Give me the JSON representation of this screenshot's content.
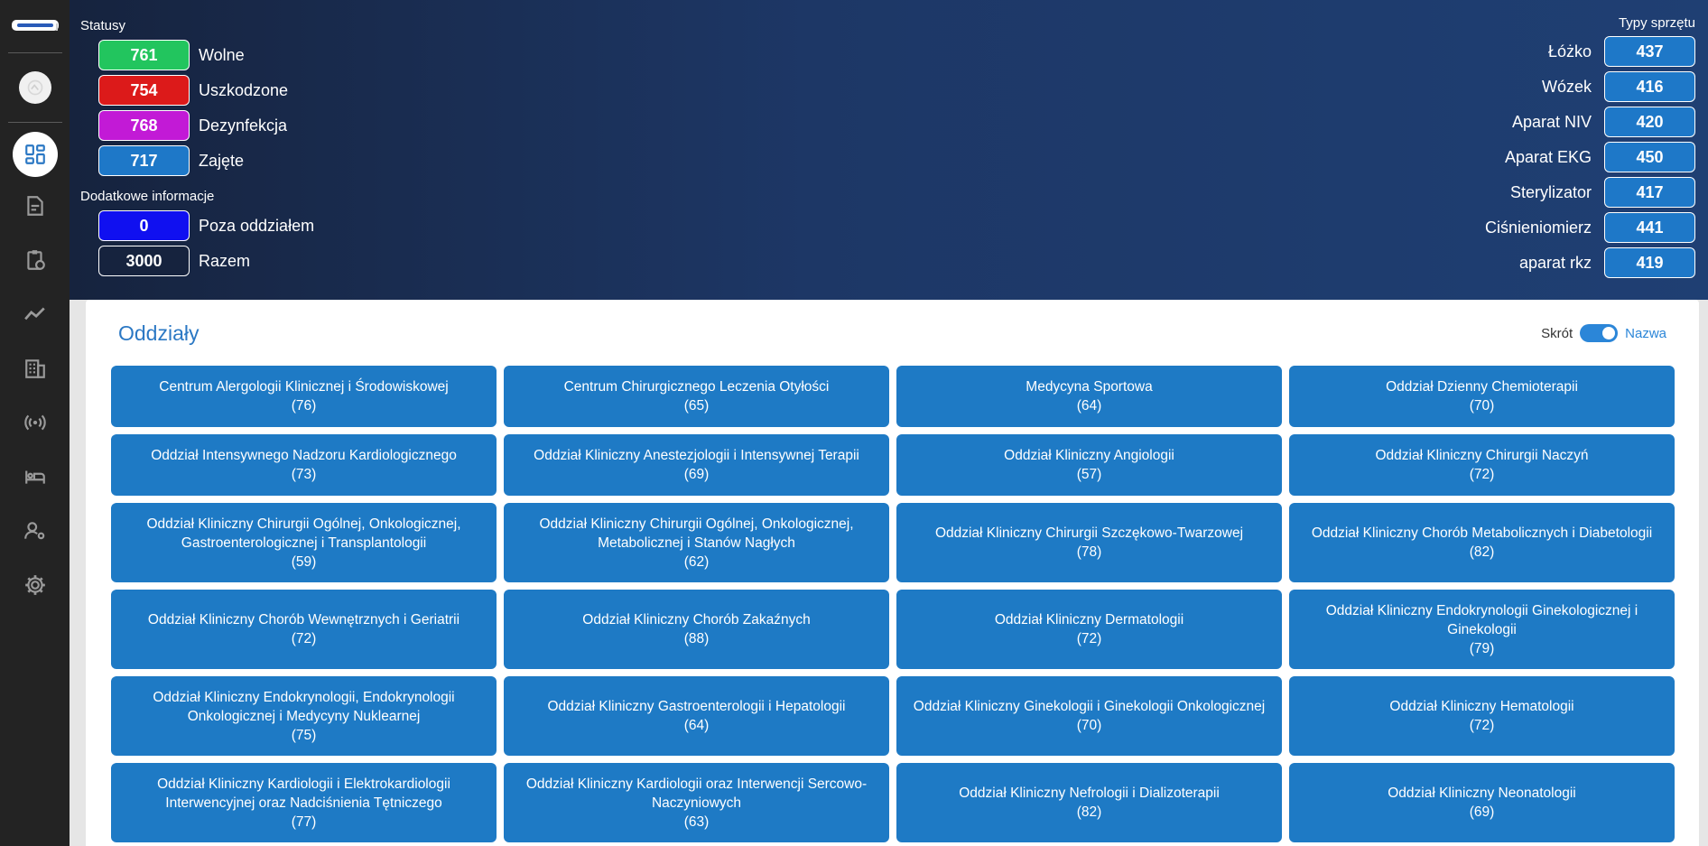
{
  "sidebar": {
    "icons": [
      "logo",
      "avatar-icon",
      "dashboard-icon",
      "document-icon",
      "clipboard-clock-icon",
      "chart-line-icon",
      "building-icon",
      "broadcast-icon",
      "bed-icon",
      "user-gear-icon",
      "gear-icon"
    ],
    "active": "dashboard-icon"
  },
  "statuses": {
    "label": "Statusy",
    "items": [
      {
        "value": "761",
        "label": "Wolne",
        "color": "#22c55e"
      },
      {
        "value": "754",
        "label": "Uszkodzone",
        "color": "#dc1a1a"
      },
      {
        "value": "768",
        "label": "Dezynfekcja",
        "color": "#c21ad6"
      },
      {
        "value": "717",
        "label": "Zajęte",
        "color": "#1e78c8"
      }
    ]
  },
  "extra": {
    "label": "Dodatkowe informacje",
    "items": [
      {
        "value": "0",
        "label": "Poza oddziałem",
        "color": "#1010f0"
      },
      {
        "value": "3000",
        "label": "Razem",
        "color": "#16233e"
      }
    ]
  },
  "equipment": {
    "label": "Typy sprzętu",
    "items": [
      {
        "label": "Łóżko",
        "value": "437"
      },
      {
        "label": "Wózek",
        "value": "416"
      },
      {
        "label": "Aparat NIV",
        "value": "420"
      },
      {
        "label": "Aparat EKG",
        "value": "450"
      },
      {
        "label": "Sterylizator",
        "value": "417"
      },
      {
        "label": "Ciśnieniomierz",
        "value": "441"
      },
      {
        "label": "aparat rkz",
        "value": "419"
      }
    ]
  },
  "departments": {
    "title": "Oddziały",
    "toggle_left": "Skrót",
    "toggle_right": "Nazwa",
    "items": [
      {
        "name": "Centrum Alergologii Klinicznej i Środowiskowej",
        "count": "(76)"
      },
      {
        "name": "Centrum Chirurgicznego Leczenia Otyłości",
        "count": "(65)"
      },
      {
        "name": "Medycyna Sportowa",
        "count": "(64)"
      },
      {
        "name": "Oddział Dzienny Chemioterapii",
        "count": "(70)"
      },
      {
        "name": "Oddział Intensywnego Nadzoru Kardiologicznego",
        "count": "(73)"
      },
      {
        "name": "Oddział Kliniczny Anestezjologii i Intensywnej Terapii",
        "count": "(69)"
      },
      {
        "name": "Oddział Kliniczny Angiologii",
        "count": "(57)"
      },
      {
        "name": "Oddział Kliniczny Chirurgii Naczyń",
        "count": "(72)"
      },
      {
        "name": "Oddział Kliniczny Chirurgii Ogólnej, Onkologicznej, Gastroenterologicznej i Transplantologii",
        "count": "(59)"
      },
      {
        "name": "Oddział Kliniczny Chirurgii Ogólnej, Onkologicznej, Metabolicznej i Stanów Nagłych",
        "count": "(62)"
      },
      {
        "name": "Oddział Kliniczny Chirurgii Szczękowo-Twarzowej",
        "count": "(78)"
      },
      {
        "name": "Oddział Kliniczny Chorób Metabolicznych i Diabetologii",
        "count": "(82)"
      },
      {
        "name": "Oddział Kliniczny Chorób Wewnętrznych i Geriatrii",
        "count": "(72)"
      },
      {
        "name": "Oddział Kliniczny Chorób Zakaźnych",
        "count": "(88)"
      },
      {
        "name": "Oddział Kliniczny Dermatologii",
        "count": "(72)"
      },
      {
        "name": "Oddział Kliniczny Endokrynologii Ginekologicznej i Ginekologii",
        "count": "(79)"
      },
      {
        "name": "Oddział Kliniczny Endokrynologii, Endokrynologii Onkologicznej i Medycyny Nuklearnej",
        "count": "(75)"
      },
      {
        "name": "Oddział Kliniczny Gastroenterologii i Hepatologii",
        "count": "(64)"
      },
      {
        "name": "Oddział Kliniczny Ginekologii i Ginekologii Onkologicznej",
        "count": "(70)"
      },
      {
        "name": "Oddział Kliniczny Hematologii",
        "count": "(72)"
      },
      {
        "name": "Oddział Kliniczny Kardiologii i Elektrokardiologii Interwencyjnej oraz Nadciśnienia Tętniczego",
        "count": "(77)"
      },
      {
        "name": "Oddział Kliniczny Kardiologii oraz Interwencji Sercowo-Naczyniowych",
        "count": "(63)"
      },
      {
        "name": "Oddział Kliniczny Nefrologii i Dializoterapii",
        "count": "(82)"
      },
      {
        "name": "Oddział Kliniczny Neonatologii",
        "count": "(69)"
      }
    ]
  }
}
